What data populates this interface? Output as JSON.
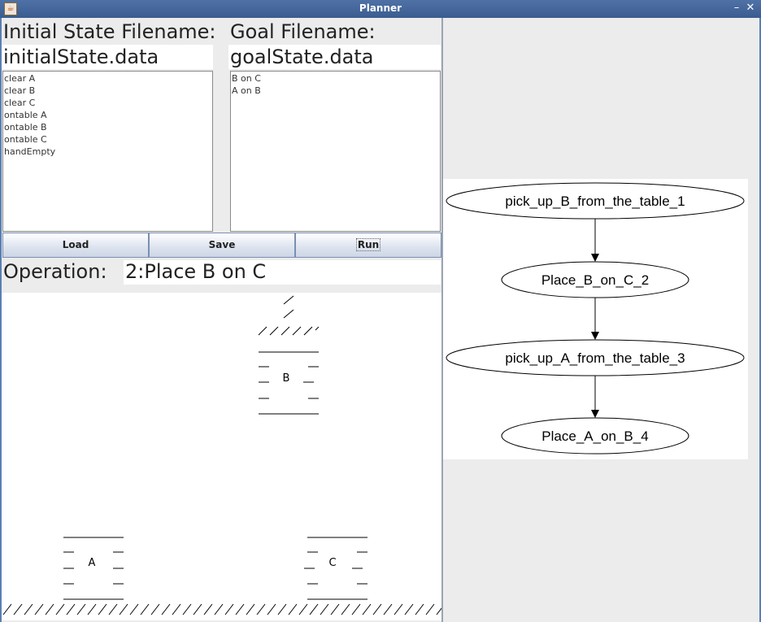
{
  "window": {
    "title": "Planner",
    "minimize": "–",
    "close": "✕",
    "icon": "java-icon"
  },
  "initial": {
    "label": "Initial State Filename:",
    "filename": "initialState.data",
    "items": [
      "clear A",
      "clear B",
      "clear C",
      "ontable A",
      "ontable B",
      "ontable C",
      "handEmpty"
    ]
  },
  "goal": {
    "label": "Goal Filename:",
    "filename": "goalState.data",
    "items": [
      "B on C",
      "A on B"
    ]
  },
  "buttons": {
    "load": "Load",
    "save": "Save",
    "run": "Run"
  },
  "operation": {
    "label": "Operation:",
    "value": "2:Place B on C"
  },
  "blocks": {
    "a": "A",
    "b": "B",
    "c": "C"
  },
  "plan": {
    "nodes": [
      "pick_up_B_from_the_table_1",
      "Place_B_on_C_2",
      "pick_up_A_from_the_table_3",
      "Place_A_on_B_4"
    ]
  }
}
